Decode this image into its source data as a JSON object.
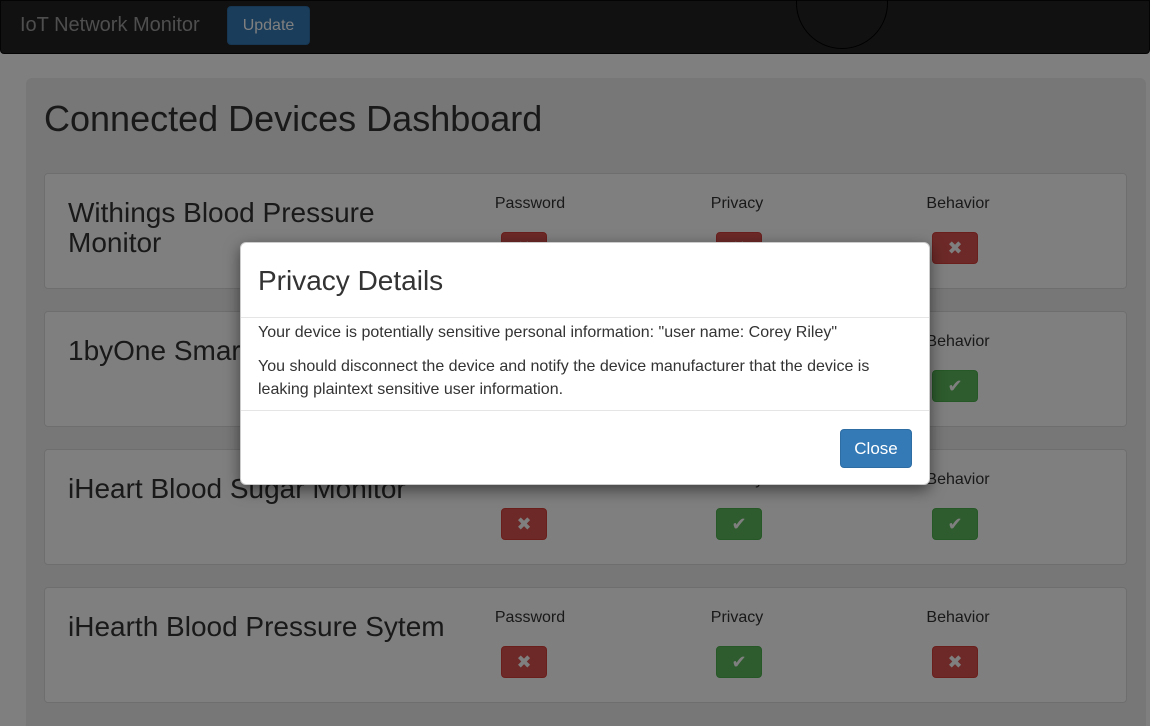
{
  "navbar": {
    "brand": "IoT Network Monitor",
    "update_label": "Update"
  },
  "page_title": "Connected Devices Dashboard",
  "columns": {
    "password": "Password",
    "privacy": "Privacy",
    "behavior": "Behavior"
  },
  "devices": [
    {
      "name": "Withings Blood Pressure Monitor",
      "password": "fail",
      "privacy": "fail",
      "behavior": "fail"
    },
    {
      "name": "1byOne Smart Scale",
      "password": "fail",
      "privacy": "fail",
      "behavior": "pass"
    },
    {
      "name": "iHeart Blood Sugar Monitor",
      "password": "fail",
      "privacy": "pass",
      "behavior": "pass"
    },
    {
      "name": "iHearth Blood Pressure Sytem",
      "password": "fail",
      "privacy": "pass",
      "behavior": "fail"
    }
  ],
  "status_icons": {
    "pass": "✔",
    "fail": "✖"
  },
  "colors": {
    "pass": "#5cb85c",
    "fail": "#d9534f",
    "primary": "#337ab7"
  },
  "modal": {
    "title": "Privacy Details",
    "line1": "Your device is potentially sensitive personal information: \"user name: Corey Riley\"",
    "line2": "You should disconnect the device and notify the device manufacturer that the device is leaking plaintext sensitive user information.",
    "close_label": "Close"
  }
}
